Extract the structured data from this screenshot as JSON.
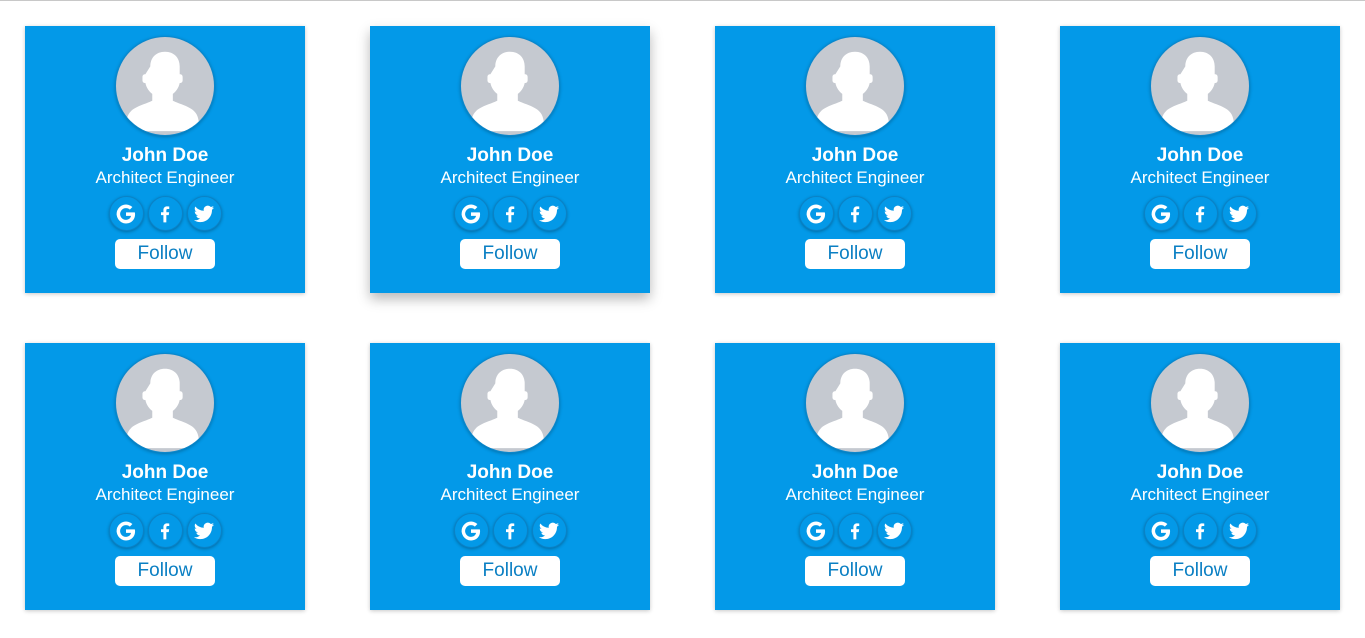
{
  "colors": {
    "card_background": "#0399e8",
    "avatar_background": "#c5c9d0",
    "button_text": "#0a7fc3",
    "text": "#ffffff"
  },
  "cards": [
    {
      "name": "John Doe",
      "title": "Architect Engineer",
      "socials": [
        "google-icon",
        "facebook-icon",
        "twitter-icon"
      ],
      "follow_label": "Follow"
    },
    {
      "name": "John Doe",
      "title": "Architect Engineer",
      "socials": [
        "google-icon",
        "facebook-icon",
        "twitter-icon"
      ],
      "follow_label": "Follow"
    },
    {
      "name": "John Doe",
      "title": "Architect Engineer",
      "socials": [
        "google-icon",
        "facebook-icon",
        "twitter-icon"
      ],
      "follow_label": "Follow"
    },
    {
      "name": "John Doe",
      "title": "Architect Engineer",
      "socials": [
        "google-icon",
        "facebook-icon",
        "twitter-icon"
      ],
      "follow_label": "Follow"
    },
    {
      "name": "John Doe",
      "title": "Architect Engineer",
      "socials": [
        "google-icon",
        "facebook-icon",
        "twitter-icon"
      ],
      "follow_label": "Follow"
    },
    {
      "name": "John Doe",
      "title": "Architect Engineer",
      "socials": [
        "google-icon",
        "facebook-icon",
        "twitter-icon"
      ],
      "follow_label": "Follow"
    },
    {
      "name": "John Doe",
      "title": "Architect Engineer",
      "socials": [
        "google-icon",
        "facebook-icon",
        "twitter-icon"
      ],
      "follow_label": "Follow"
    },
    {
      "name": "John Doe",
      "title": "Architect Engineer",
      "socials": [
        "google-icon",
        "facebook-icon",
        "twitter-icon"
      ],
      "follow_label": "Follow"
    }
  ]
}
